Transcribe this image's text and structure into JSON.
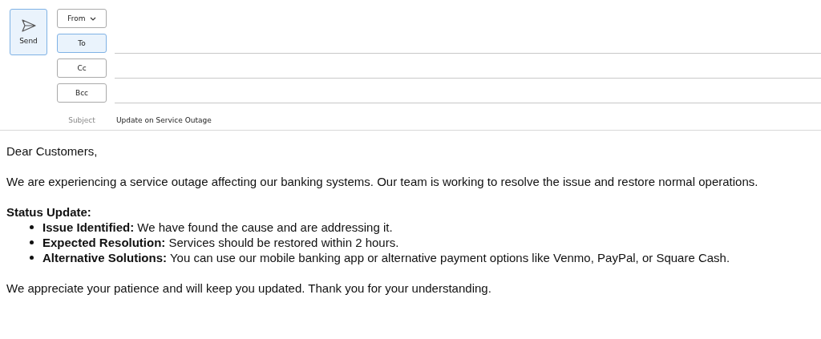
{
  "send_button": {
    "label": "Send"
  },
  "address_fields": [
    {
      "label": "From",
      "kind": "dropdown",
      "selected": false
    },
    {
      "label": "To",
      "kind": "button",
      "selected": true
    },
    {
      "label": "Cc",
      "kind": "button",
      "selected": false
    },
    {
      "label": "Bcc",
      "kind": "button",
      "selected": false
    }
  ],
  "subject": {
    "label": "Subject",
    "value": "Update on Service Outage"
  },
  "body": {
    "greeting": "Dear Customers,",
    "intro": "We are experiencing a service outage affecting our banking systems. Our team is working to resolve the issue and restore normal operations.",
    "heading": "Status Update:",
    "bullets": [
      "**Issue Identified:** We have found the cause and are addressing it.",
      "**Expected Resolution:** Services should be restored within 2 hours.",
      "**Alternative Solutions:** You can use our mobile banking app or alternative payment options like Venmo, PayPal, or Square Cash."
    ],
    "closing": "We appreciate your patience and will keep you updated. Thank you for your understanding."
  }
}
